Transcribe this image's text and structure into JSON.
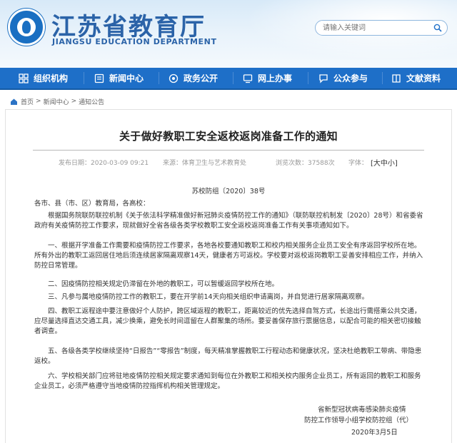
{
  "header": {
    "site_title": "江苏省教育厅",
    "site_subtitle": "JIANGSU EDUCATION DEPARTMENT",
    "search_placeholder": "请输入关键词"
  },
  "nav": {
    "items": [
      {
        "label": "组织机构",
        "icon": "org-icon"
      },
      {
        "label": "新闻中心",
        "icon": "news-icon"
      },
      {
        "label": "政务公开",
        "icon": "gov-icon"
      },
      {
        "label": "网上办事",
        "icon": "service-icon"
      },
      {
        "label": "公众参与",
        "icon": "public-icon"
      },
      {
        "label": "文献资料",
        "icon": "docs-icon"
      }
    ]
  },
  "breadcrumb": {
    "home": "首页",
    "items": [
      "新闻中心",
      "通知公告"
    ]
  },
  "article": {
    "title": "关于做好教职工安全返校返岗准备工作的通知",
    "meta": {
      "date": "发布日期：2020-03-09 09:21",
      "source": "来源：体育卫生与艺术教育处",
      "views": "浏览次数：37588次",
      "font_label": "字体：",
      "font_sizes": [
        "大",
        "中",
        "小"
      ]
    },
    "doc_number": "苏校防组〔2020〕38号",
    "salutation": "各市、县（市、区）教育局，各高校：",
    "paragraphs": [
      "根据国务院联防联控机制《关于依法科学精准做好新冠肺炎疫情防控工作的通知》（联防联控机制发〔2020〕28号）和省委省政府有关疫情防控工作要求，现就做好全省各级各类学校教职工安全返校返岗准备工作有关事项通知如下。",
      "一、根据开学准备工作需要和疫情防控工作要求，各地各校要通知教职工和校内相关服务企业员工安全有序返回学校所在地。所有外出的教职工返回居住地后须连续居家隔离观察14天，健康者方可返校。学校要对返校返岗教职工妥善安排相应工作，并纳入防控日常管理。",
      "二、因疫情防控相关规定仍滞留在外地的教职工，可以暂缓返回学校所在地。",
      "三、凡参与属地疫情防控工作的教职工，要在开学前14天向相关组织申请离岗，并自觉进行居家隔离观察。",
      "四、教职工返程途中要注意做好个人防护，跨区域返程的教职工，距离较近的优先选择自驾方式，长途出行需搭乘公共交通，应尽量选择直达交通工具，减少换乘，避免长时间逗留在人群聚集的场所。要妥善保存旅行票据信息，以配合可能的相关密切接触者调查。",
      "五、各级各类学校继续坚持“日报告”“零报告”制度，每天精准掌握教职工行程动态和健康状况，坚决杜绝教职工带病、带隐患返校。",
      "六、学校相关部门应将驻地疫情防控相关规定要求通知到每位在外教职工和相关校内服务企业员工，所有返回的教职工和服务企业员工，必须严格遵守当地疫情防控指挥机构相关管理规定。"
    ],
    "signature": [
      "省新型冠状病毒感染肺炎疫情",
      "防控工作领导小组学校防控组（代）"
    ],
    "date": "2020年3月5日"
  },
  "colors": {
    "brand_blue": "#1e6fc8",
    "title_blue": "#2b63a8"
  }
}
